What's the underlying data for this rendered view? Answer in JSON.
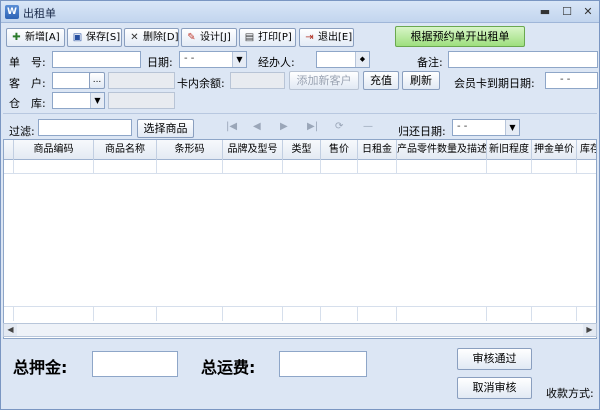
{
  "window": {
    "title": "出租单",
    "minimize": "▬",
    "maximize": "☐",
    "close": "✕"
  },
  "toolbar": {
    "add": "新增[A]",
    "save": "保存[S]",
    "delete": "删除[D]",
    "design": "设计[J]",
    "print": "打印[P]",
    "exit": "退出[E]",
    "reservation": "根据预约单开出租单"
  },
  "form": {
    "order_no_label": "单　号:",
    "date_label": "日期:",
    "date_value": "- -",
    "handler_label": "经办人:",
    "remark_label": "备注:",
    "customer_label": "客　户:",
    "customer_lookup": "...",
    "card_balance_label": "卡内余额:",
    "add_customer": "添加新客户",
    "recharge": "充值",
    "refresh": "刷新",
    "member_expiry_label": "会员卡到期日期:",
    "member_expiry_value": "- -",
    "warehouse_label": "仓　库:",
    "filter_label": "过滤:",
    "select_goods": "选择商品",
    "return_date_label": "归还日期:",
    "return_date_value": "- -"
  },
  "nav": {
    "first": "|◀",
    "prev": "◀",
    "next": "▶",
    "last": "▶|",
    "refresh": "⟳",
    "minus": "—"
  },
  "grid": {
    "columns": [
      "",
      "商品编码",
      "商品名称",
      "条形码",
      "品牌及型号",
      "类型",
      "售价",
      "日租金",
      "产品零件数量及描述",
      "新旧程度",
      "押金单价",
      "库存"
    ]
  },
  "footer": {
    "deposit_label": "总押金:",
    "freight_label": "总运费:",
    "approve": "审核通过",
    "cancel_approve": "取消审核",
    "payment_label": "收款方式:"
  }
}
